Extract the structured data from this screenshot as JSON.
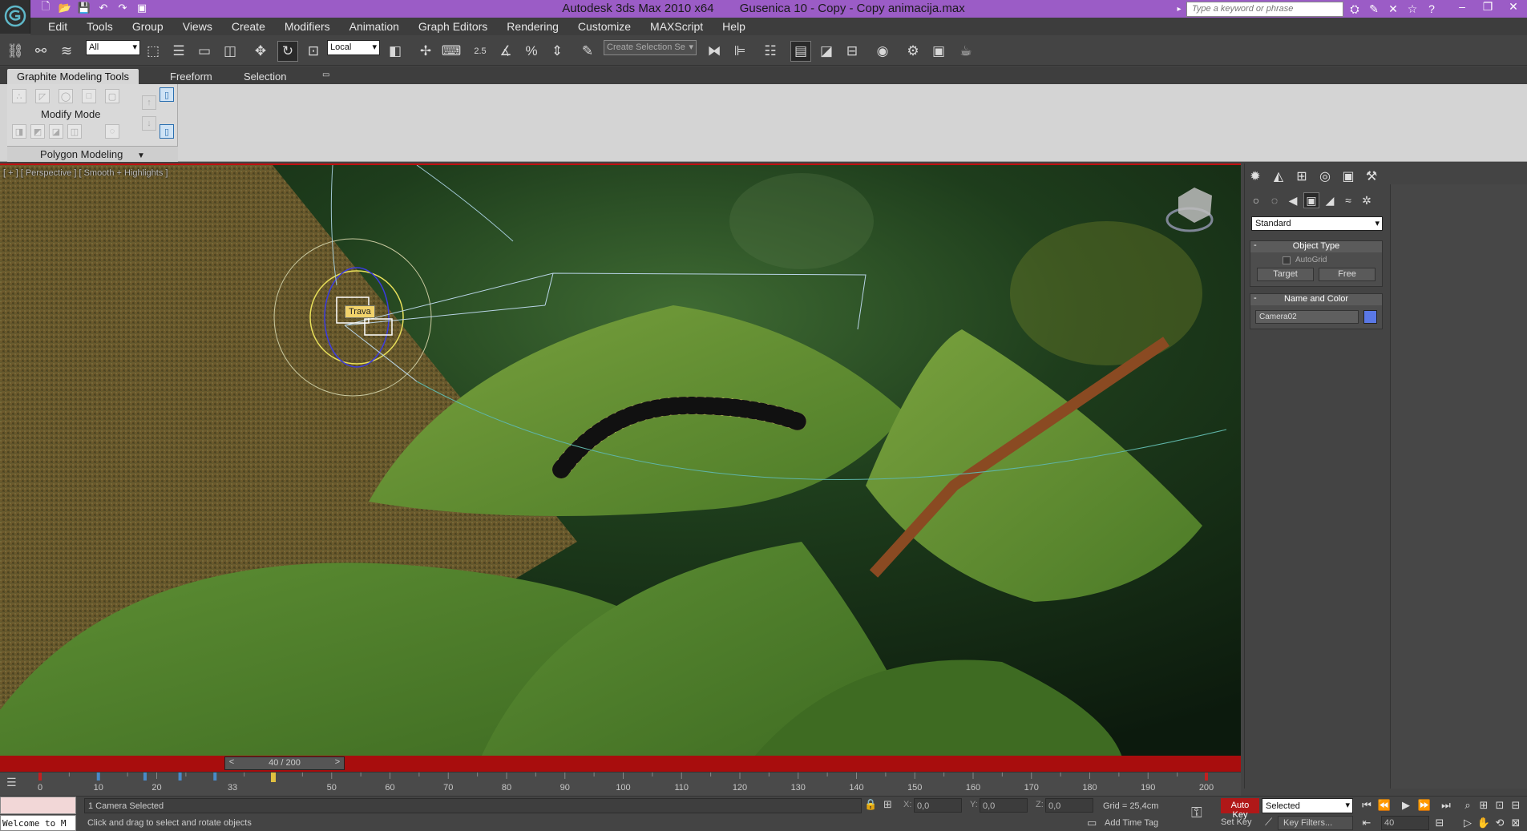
{
  "title_bar": {
    "app_name": "Autodesk 3ds Max  2010 x64",
    "file_name": "Gusenica 10 - Copy - Copy animacija.max",
    "search_placeholder": "Type a keyword or phrase"
  },
  "menu": [
    "Edit",
    "Tools",
    "Group",
    "Views",
    "Create",
    "Modifiers",
    "Animation",
    "Graph Editors",
    "Rendering",
    "Customize",
    "MAXScript",
    "Help"
  ],
  "toolbar": {
    "selection_filter": "All",
    "coordinate_system": "Local",
    "snap_angle_label": "2.5",
    "named_selection_set_placeholder": "Create Selection Se"
  },
  "ribbon": {
    "tabs": [
      "Graphite Modeling Tools",
      "Freeform",
      "Selection"
    ],
    "active_tab": "Graphite Modeling Tools",
    "panel_title": "Modify Mode",
    "panel_footer": "Polygon Modeling"
  },
  "viewport": {
    "label": "[ + ] [ Perspective ] [ Smooth + Highlights ]",
    "object_tooltip": "Trava"
  },
  "command_panel": {
    "category": "Standard",
    "object_type_title": "Object Type",
    "autogrid_label": "AutoGrid",
    "autogrid_checked": false,
    "buttons": [
      "Target",
      "Free"
    ],
    "name_color_title": "Name and Color",
    "object_name": "Camera02",
    "object_color": "#5a78e6"
  },
  "time_slider": {
    "value_label": "40 / 200",
    "current_frame": 40,
    "total_frames": 200,
    "prev_label": "<",
    "next_label": ">"
  },
  "track_bar": {
    "tick_labels": [
      "0",
      "10",
      "20",
      "33",
      "50",
      "60",
      "70",
      "80",
      "90",
      "100",
      "110",
      "120",
      "130",
      "140",
      "150",
      "160",
      "170",
      "180",
      "190",
      "200"
    ],
    "tick_frames": [
      0,
      10,
      20,
      33,
      50,
      60,
      70,
      80,
      90,
      100,
      110,
      120,
      130,
      140,
      150,
      160,
      170,
      180,
      190,
      200
    ],
    "key_frames": [
      0,
      10,
      18,
      24,
      30,
      40,
      200
    ]
  },
  "status_bar": {
    "listener_text": "Welcome to M",
    "selection_info": "1 Camera Selected",
    "prompt": "Click and drag to select and rotate objects",
    "x_label": "X:",
    "y_label": "Y:",
    "z_label": "Z:",
    "x_value": "0,0",
    "y_value": "0,0",
    "z_value": "0,0",
    "grid": "Grid = 25,4cm",
    "add_time_tag": "Add Time Tag",
    "auto_key": "Auto Key",
    "key_mode": "Selected",
    "set_key": "Set Key",
    "key_filters": "Key Filters...",
    "frame": "40"
  },
  "colors": {
    "title_bar": "#9b5cc6",
    "active_viewport_border": "#c01010",
    "auto_key": "#b01818",
    "time_slider": "#a80d0d"
  }
}
